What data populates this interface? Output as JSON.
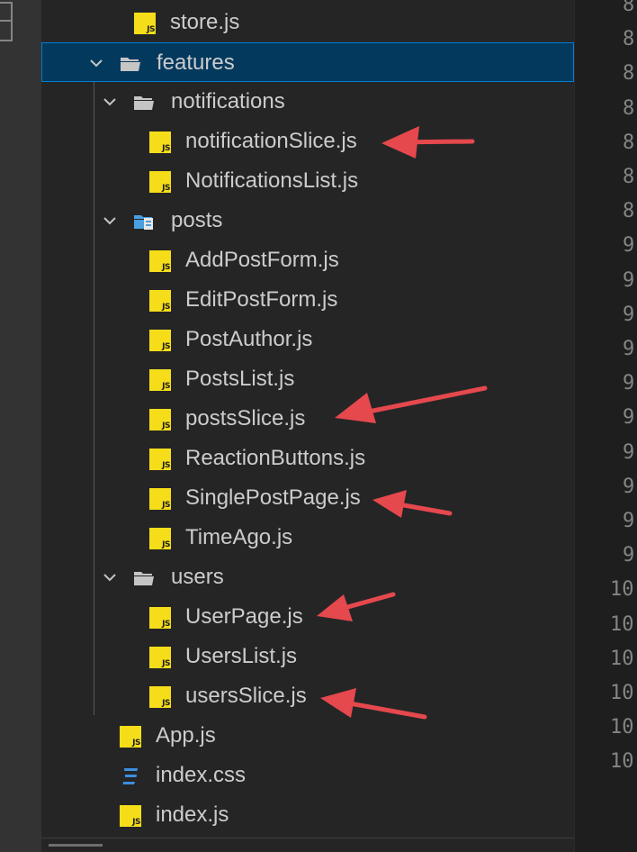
{
  "explorer": {
    "items": [
      {
        "id": "store-js",
        "label": "store.js",
        "type": "js"
      },
      {
        "id": "features",
        "label": "features",
        "type": "folder-open",
        "selected": true
      },
      {
        "id": "notifications",
        "label": "notifications",
        "type": "folder-open"
      },
      {
        "id": "notificationSlice-js",
        "label": "notificationSlice.js",
        "type": "js"
      },
      {
        "id": "NotificationsList-js",
        "label": "NotificationsList.js",
        "type": "js"
      },
      {
        "id": "posts",
        "label": "posts",
        "type": "folder-posts"
      },
      {
        "id": "AddPostForm-js",
        "label": "AddPostForm.js",
        "type": "js"
      },
      {
        "id": "EditPostForm-js",
        "label": "EditPostForm.js",
        "type": "js"
      },
      {
        "id": "PostAuthor-js",
        "label": "PostAuthor.js",
        "type": "js"
      },
      {
        "id": "PostsList-js",
        "label": "PostsList.js",
        "type": "js"
      },
      {
        "id": "postsSlice-js",
        "label": "postsSlice.js",
        "type": "js"
      },
      {
        "id": "ReactionButtons-js",
        "label": "ReactionButtons.js",
        "type": "js"
      },
      {
        "id": "SinglePostPage-js",
        "label": "SinglePostPage.js",
        "type": "js"
      },
      {
        "id": "TimeAgo-js",
        "label": "TimeAgo.js",
        "type": "js"
      },
      {
        "id": "users",
        "label": "users",
        "type": "folder-open"
      },
      {
        "id": "UserPage-js",
        "label": "UserPage.js",
        "type": "js"
      },
      {
        "id": "UsersList-js",
        "label": "UsersList.js",
        "type": "js"
      },
      {
        "id": "usersSlice-js",
        "label": "usersSlice.js",
        "type": "js"
      },
      {
        "id": "App-js",
        "label": "App.js",
        "type": "js"
      },
      {
        "id": "index-css",
        "label": "index.css",
        "type": "css"
      },
      {
        "id": "index-js",
        "label": "index.js",
        "type": "js"
      }
    ]
  },
  "gutter": {
    "line_numbers": [
      "8",
      "8",
      "8",
      "8",
      "8",
      "8",
      "8",
      "9",
      "9",
      "9",
      "9",
      "9",
      "9",
      "9",
      "9",
      "9",
      "9",
      "10",
      "10",
      "10",
      "10",
      "10",
      "10"
    ]
  },
  "colors": {
    "selection_bg": "#04395e",
    "selection_border": "#007fd4",
    "js_icon": "#f5de19",
    "css_icon": "#3d8fe0",
    "annotation_arrow": "#e5484d"
  },
  "icons": {
    "js": "js-file-icon",
    "css": "css-file-icon",
    "folder": "folder-open-icon",
    "posts_folder": "posts-folder-icon",
    "chevron": "chevron-down-icon",
    "arrow": "annotation-arrow-icon"
  }
}
